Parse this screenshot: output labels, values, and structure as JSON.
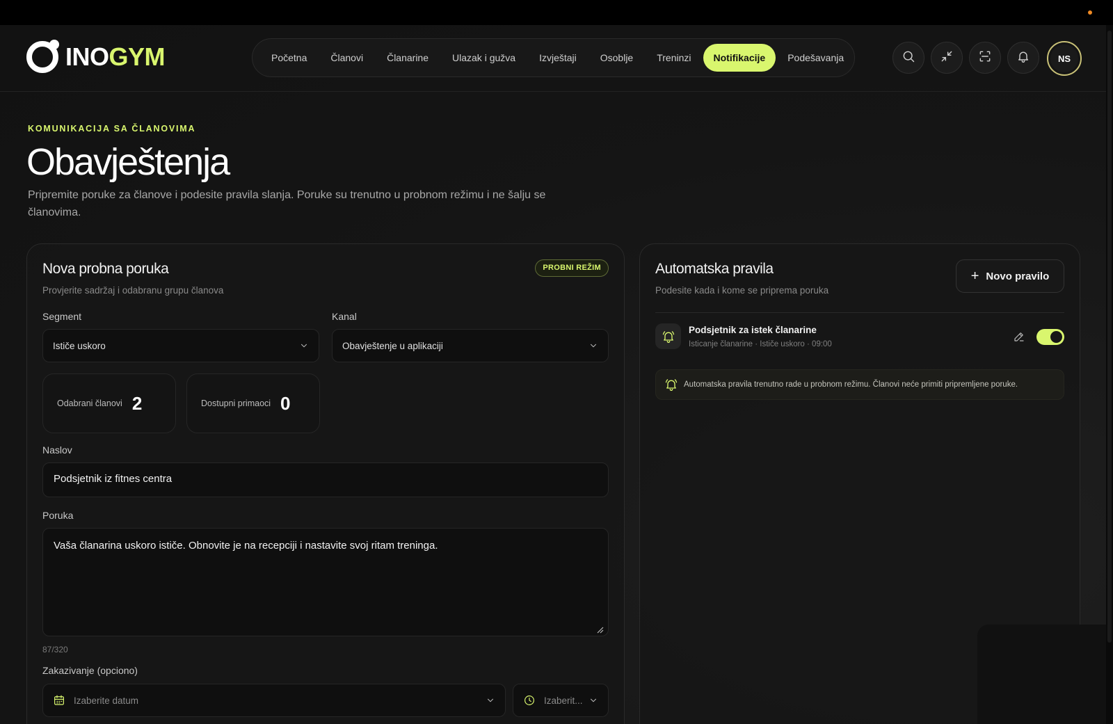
{
  "brand": {
    "part1": "INO",
    "part2": "GYM"
  },
  "nav": [
    {
      "label": "Početna",
      "active": false
    },
    {
      "label": "Članovi",
      "active": false
    },
    {
      "label": "Članarine",
      "active": false
    },
    {
      "label": "Ulazak i gužva",
      "active": false
    },
    {
      "label": "Izvještaji",
      "active": false
    },
    {
      "label": "Osoblje",
      "active": false
    },
    {
      "label": "Treninzi",
      "active": false
    },
    {
      "label": "Notifikacije",
      "active": true
    },
    {
      "label": "Podešavanja",
      "active": false
    }
  ],
  "header_actions": {
    "icons": [
      "search-icon",
      "collapse-icon",
      "scan-icon",
      "bell-icon"
    ],
    "avatar_initials": "NS"
  },
  "page": {
    "eyebrow": "KOMUNIKACIJA SA ČLANOVIMA",
    "title": "Obavještenja",
    "description": "Pripremite poruke za članove i podesite pravila slanja. Poruke su trenutno u probnom režimu i ne šalju se članovima."
  },
  "compose": {
    "title": "Nova probna poruka",
    "subtitle": "Provjerite sadržaj i odabranu grupu članova",
    "badge": "PROBNI REŽIM",
    "segment_label": "Segment",
    "segment_value": "Ističe uskoro",
    "channel_label": "Kanal",
    "channel_value": "Obavještenje u aplikaciji",
    "stats": [
      {
        "label": "Odabrani članovi",
        "value": "2"
      },
      {
        "label": "Dostupni primaoci",
        "value": "0"
      }
    ],
    "title_label": "Naslov",
    "title_value": "Podsjetnik iz fitnes centra",
    "message_label": "Poruka",
    "message_value": "Vaša članarina uskoro ističe. Obnovite je na recepciji i nastavite svoj ritam treninga.",
    "counter": "87/320",
    "schedule_label": "Zakazivanje (opciono)",
    "date_placeholder": "Izaberite datum",
    "time_placeholder": "Izaberit..."
  },
  "rules": {
    "title": "Automatska pravila",
    "subtitle": "Podesite kada i kome se priprema poruka",
    "new_button": "Novo pravilo",
    "items": [
      {
        "name": "Podsjetnik za istek članarine",
        "meta": "Isticanje članarine · Ističe uskoro · 09:00",
        "enabled": true
      }
    ],
    "note": "Automatska pravila trenutno rade u probnom režimu. Članovi neće primiti pripremljene poruke."
  },
  "colors": {
    "accent": "#d9f66e",
    "background": "#141414"
  }
}
